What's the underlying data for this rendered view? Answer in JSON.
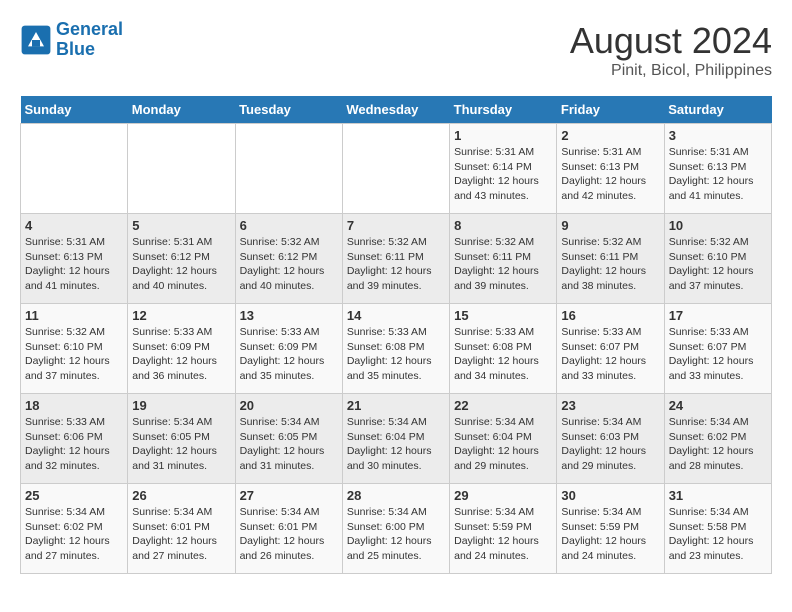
{
  "logo": {
    "line1": "General",
    "line2": "Blue"
  },
  "title": "August 2024",
  "subtitle": "Pinit, Bicol, Philippines",
  "days_of_week": [
    "Sunday",
    "Monday",
    "Tuesday",
    "Wednesday",
    "Thursday",
    "Friday",
    "Saturday"
  ],
  "weeks": [
    [
      {
        "day": "",
        "info": ""
      },
      {
        "day": "",
        "info": ""
      },
      {
        "day": "",
        "info": ""
      },
      {
        "day": "",
        "info": ""
      },
      {
        "day": "1",
        "info": "Sunrise: 5:31 AM\nSunset: 6:14 PM\nDaylight: 12 hours\nand 43 minutes."
      },
      {
        "day": "2",
        "info": "Sunrise: 5:31 AM\nSunset: 6:13 PM\nDaylight: 12 hours\nand 42 minutes."
      },
      {
        "day": "3",
        "info": "Sunrise: 5:31 AM\nSunset: 6:13 PM\nDaylight: 12 hours\nand 41 minutes."
      }
    ],
    [
      {
        "day": "4",
        "info": "Sunrise: 5:31 AM\nSunset: 6:13 PM\nDaylight: 12 hours\nand 41 minutes."
      },
      {
        "day": "5",
        "info": "Sunrise: 5:31 AM\nSunset: 6:12 PM\nDaylight: 12 hours\nand 40 minutes."
      },
      {
        "day": "6",
        "info": "Sunrise: 5:32 AM\nSunset: 6:12 PM\nDaylight: 12 hours\nand 40 minutes."
      },
      {
        "day": "7",
        "info": "Sunrise: 5:32 AM\nSunset: 6:11 PM\nDaylight: 12 hours\nand 39 minutes."
      },
      {
        "day": "8",
        "info": "Sunrise: 5:32 AM\nSunset: 6:11 PM\nDaylight: 12 hours\nand 39 minutes."
      },
      {
        "day": "9",
        "info": "Sunrise: 5:32 AM\nSunset: 6:11 PM\nDaylight: 12 hours\nand 38 minutes."
      },
      {
        "day": "10",
        "info": "Sunrise: 5:32 AM\nSunset: 6:10 PM\nDaylight: 12 hours\nand 37 minutes."
      }
    ],
    [
      {
        "day": "11",
        "info": "Sunrise: 5:32 AM\nSunset: 6:10 PM\nDaylight: 12 hours\nand 37 minutes."
      },
      {
        "day": "12",
        "info": "Sunrise: 5:33 AM\nSunset: 6:09 PM\nDaylight: 12 hours\nand 36 minutes."
      },
      {
        "day": "13",
        "info": "Sunrise: 5:33 AM\nSunset: 6:09 PM\nDaylight: 12 hours\nand 35 minutes."
      },
      {
        "day": "14",
        "info": "Sunrise: 5:33 AM\nSunset: 6:08 PM\nDaylight: 12 hours\nand 35 minutes."
      },
      {
        "day": "15",
        "info": "Sunrise: 5:33 AM\nSunset: 6:08 PM\nDaylight: 12 hours\nand 34 minutes."
      },
      {
        "day": "16",
        "info": "Sunrise: 5:33 AM\nSunset: 6:07 PM\nDaylight: 12 hours\nand 33 minutes."
      },
      {
        "day": "17",
        "info": "Sunrise: 5:33 AM\nSunset: 6:07 PM\nDaylight: 12 hours\nand 33 minutes."
      }
    ],
    [
      {
        "day": "18",
        "info": "Sunrise: 5:33 AM\nSunset: 6:06 PM\nDaylight: 12 hours\nand 32 minutes."
      },
      {
        "day": "19",
        "info": "Sunrise: 5:34 AM\nSunset: 6:05 PM\nDaylight: 12 hours\nand 31 minutes."
      },
      {
        "day": "20",
        "info": "Sunrise: 5:34 AM\nSunset: 6:05 PM\nDaylight: 12 hours\nand 31 minutes."
      },
      {
        "day": "21",
        "info": "Sunrise: 5:34 AM\nSunset: 6:04 PM\nDaylight: 12 hours\nand 30 minutes."
      },
      {
        "day": "22",
        "info": "Sunrise: 5:34 AM\nSunset: 6:04 PM\nDaylight: 12 hours\nand 29 minutes."
      },
      {
        "day": "23",
        "info": "Sunrise: 5:34 AM\nSunset: 6:03 PM\nDaylight: 12 hours\nand 29 minutes."
      },
      {
        "day": "24",
        "info": "Sunrise: 5:34 AM\nSunset: 6:02 PM\nDaylight: 12 hours\nand 28 minutes."
      }
    ],
    [
      {
        "day": "25",
        "info": "Sunrise: 5:34 AM\nSunset: 6:02 PM\nDaylight: 12 hours\nand 27 minutes."
      },
      {
        "day": "26",
        "info": "Sunrise: 5:34 AM\nSunset: 6:01 PM\nDaylight: 12 hours\nand 27 minutes."
      },
      {
        "day": "27",
        "info": "Sunrise: 5:34 AM\nSunset: 6:01 PM\nDaylight: 12 hours\nand 26 minutes."
      },
      {
        "day": "28",
        "info": "Sunrise: 5:34 AM\nSunset: 6:00 PM\nDaylight: 12 hours\nand 25 minutes."
      },
      {
        "day": "29",
        "info": "Sunrise: 5:34 AM\nSunset: 5:59 PM\nDaylight: 12 hours\nand 24 minutes."
      },
      {
        "day": "30",
        "info": "Sunrise: 5:34 AM\nSunset: 5:59 PM\nDaylight: 12 hours\nand 24 minutes."
      },
      {
        "day": "31",
        "info": "Sunrise: 5:34 AM\nSunset: 5:58 PM\nDaylight: 12 hours\nand 23 minutes."
      }
    ]
  ]
}
